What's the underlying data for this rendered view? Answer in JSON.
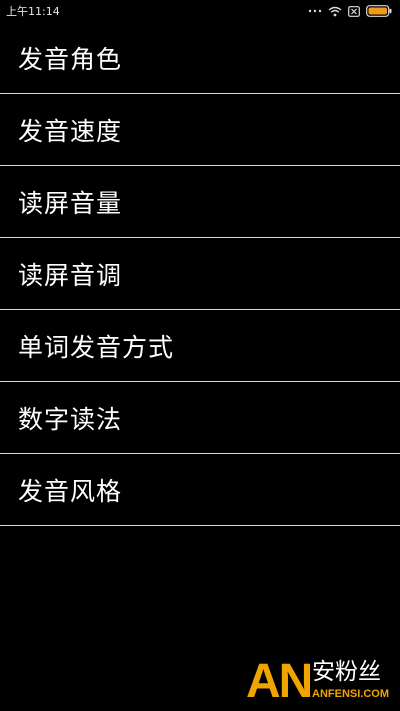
{
  "status_bar": {
    "time": "上午11:14",
    "icons": [
      "dots-icon",
      "wifi-icon",
      "close-box-icon",
      "battery-icon"
    ]
  },
  "menu": {
    "items": [
      {
        "label": "发音角色"
      },
      {
        "label": "发音速度"
      },
      {
        "label": "读屏音量"
      },
      {
        "label": "读屏音调"
      },
      {
        "label": "单词发音方式"
      },
      {
        "label": "数字读法"
      },
      {
        "label": "发音风格"
      }
    ]
  },
  "watermark": {
    "logo_text": "AN",
    "cn_text": "安粉丝",
    "url_text": "ANFENSI.COM",
    "accent_color": "#f0a400"
  }
}
